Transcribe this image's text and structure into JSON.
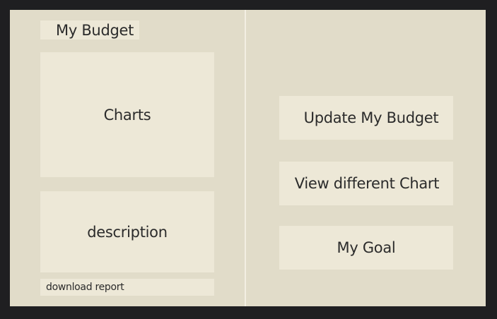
{
  "left_panel": {
    "title": "My Budget",
    "charts_label": "Charts",
    "description_label": "description",
    "download_label": "download report"
  },
  "right_panel": {
    "update_label": "Update My Budget",
    "view_chart_label": "View different Chart",
    "goal_label": "My Goal"
  }
}
